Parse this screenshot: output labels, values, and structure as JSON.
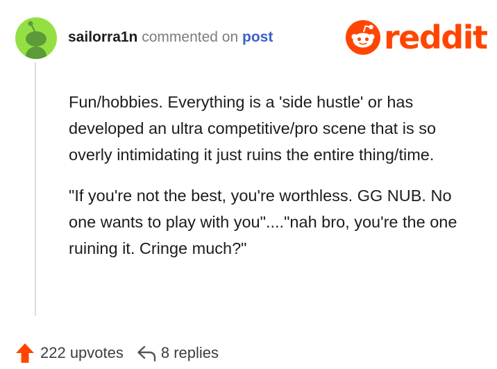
{
  "comment": {
    "username": "sailorra1n",
    "action_text": "commented on",
    "post_link": "post",
    "paragraphs": [
      "Fun/hobbies. Everything is a 'side hustle' or has developed an ultra competitive/pro scene that is so overly intimidating it just ruins the entire thing/time.",
      "\"If you're not the best, you're worthless. GG NUB. No one wants to play with you\"....\"nah bro, you're the one ruining it. Cringe much?\""
    ]
  },
  "brand": {
    "logo_text": "reddit",
    "color": "#ff4500"
  },
  "footer": {
    "upvotes": "222 upvotes",
    "replies": "8 replies"
  },
  "colors": {
    "avatar_bg": "#94e044",
    "avatar_figure": "#5d9a38",
    "link": "#3a5fc9",
    "upvote": "#ff4500"
  }
}
